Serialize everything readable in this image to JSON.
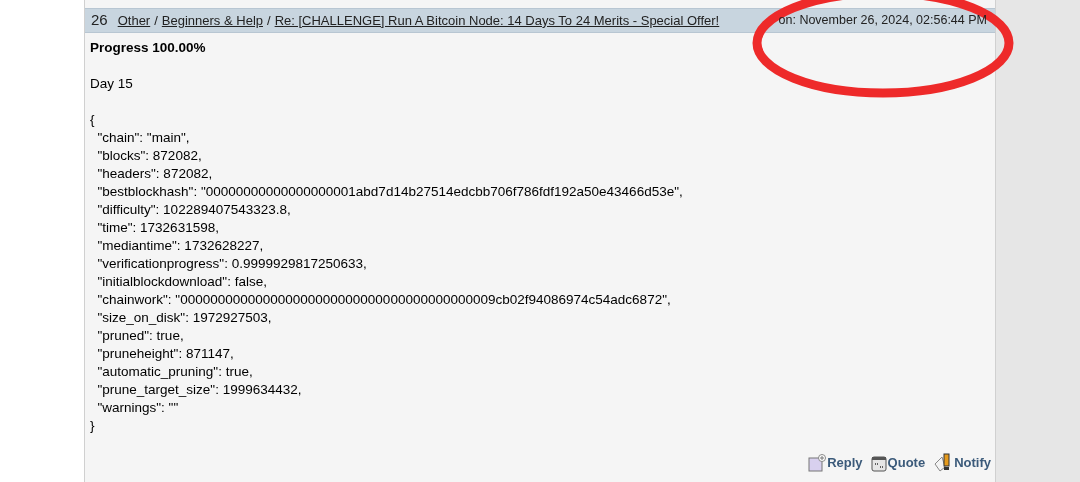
{
  "post": {
    "number": "26",
    "separator": "/",
    "breadcrumbs": [
      "Other",
      "Beginners & Help",
      "Re: [CHALLENGE] Run A Bitcoin Node: 14 Days To 24 Merits - Special Offer!"
    ],
    "date": "on: November 26, 2024, 02:56:44 PM",
    "body": [
      {
        "kind": "heading",
        "text": "Progress 100.00%"
      },
      {
        "kind": "text",
        "text": "Day 15"
      },
      {
        "kind": "code",
        "lines": [
          "{",
          "  \"chain\": \"main\",",
          "  \"blocks\": 872082,",
          "  \"headers\": 872082,",
          "  \"bestblockhash\": \"00000000000000000001abd7d14b27514edcbb706f786fdf192a50e43466d53e\",",
          "  \"difficulty\": 102289407543323.8,",
          "  \"time\": 1732631598,",
          "  \"mediantime\": 1732628227,",
          "  \"verificationprogress\": 0.9999929817250633,",
          "  \"initialblockdownload\": false,",
          "  \"chainwork\": \"000000000000000000000000000000000000000009cb02f94086974c54adc6872\",",
          "  \"size_on_disk\": 1972927503,",
          "  \"pruned\": true,",
          "  \"pruneheight\": 871147,",
          "  \"automatic_pruning\": true,",
          "  \"prune_target_size\": 1999634432,",
          "  \"warnings\": \"\"",
          "}"
        ]
      }
    ],
    "actions": [
      {
        "kind": "reply",
        "label": "Reply"
      },
      {
        "kind": "quote",
        "label": "Quote"
      },
      {
        "kind": "notify",
        "label": "Notify"
      }
    ]
  }
}
